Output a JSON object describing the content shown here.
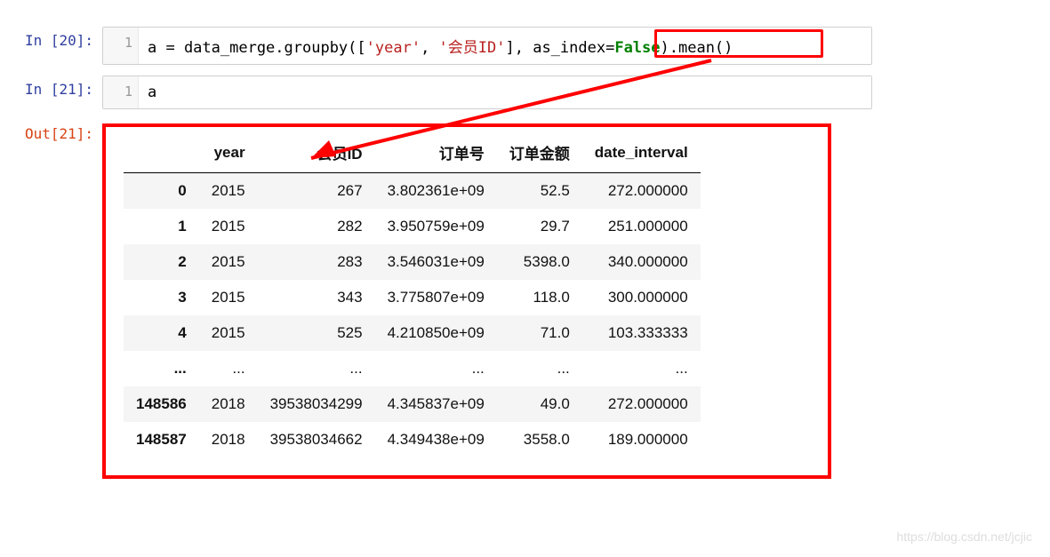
{
  "cells": {
    "in20": {
      "prompt": "In  [20]:",
      "lineno": "1",
      "code_parts": {
        "p1": "a = data_merge.groupby([",
        "s1": "'year'",
        "p2": ", ",
        "s2": "'会员ID'",
        "p3": "], as_index=",
        "kw": "False",
        "p4": ").mean()"
      }
    },
    "in21": {
      "prompt": "In  [21]:",
      "lineno": "1",
      "code": "a"
    },
    "out21": {
      "prompt": "Out[21]:"
    }
  },
  "dataframe": {
    "columns": [
      "year",
      "会员ID",
      "订单号",
      "订单金额",
      "date_interval"
    ],
    "rows": [
      {
        "idx": "0",
        "cells": [
          "2015",
          "267",
          "3.802361e+09",
          "52.5",
          "272.000000"
        ]
      },
      {
        "idx": "1",
        "cells": [
          "2015",
          "282",
          "3.950759e+09",
          "29.7",
          "251.000000"
        ]
      },
      {
        "idx": "2",
        "cells": [
          "2015",
          "283",
          "3.546031e+09",
          "5398.0",
          "340.000000"
        ]
      },
      {
        "idx": "3",
        "cells": [
          "2015",
          "343",
          "3.775807e+09",
          "118.0",
          "300.000000"
        ]
      },
      {
        "idx": "4",
        "cells": [
          "2015",
          "525",
          "4.210850e+09",
          "71.0",
          "103.333333"
        ]
      },
      {
        "idx": "...",
        "cells": [
          "...",
          "...",
          "...",
          "...",
          "..."
        ]
      },
      {
        "idx": "148586",
        "cells": [
          "2018",
          "39538034299",
          "4.345837e+09",
          "49.0",
          "272.000000"
        ]
      },
      {
        "idx": "148587",
        "cells": [
          "2018",
          "39538034662",
          "4.349438e+09",
          "3558.0",
          "189.000000"
        ]
      }
    ]
  },
  "watermark": "https://blog.csdn.net/jcjic"
}
